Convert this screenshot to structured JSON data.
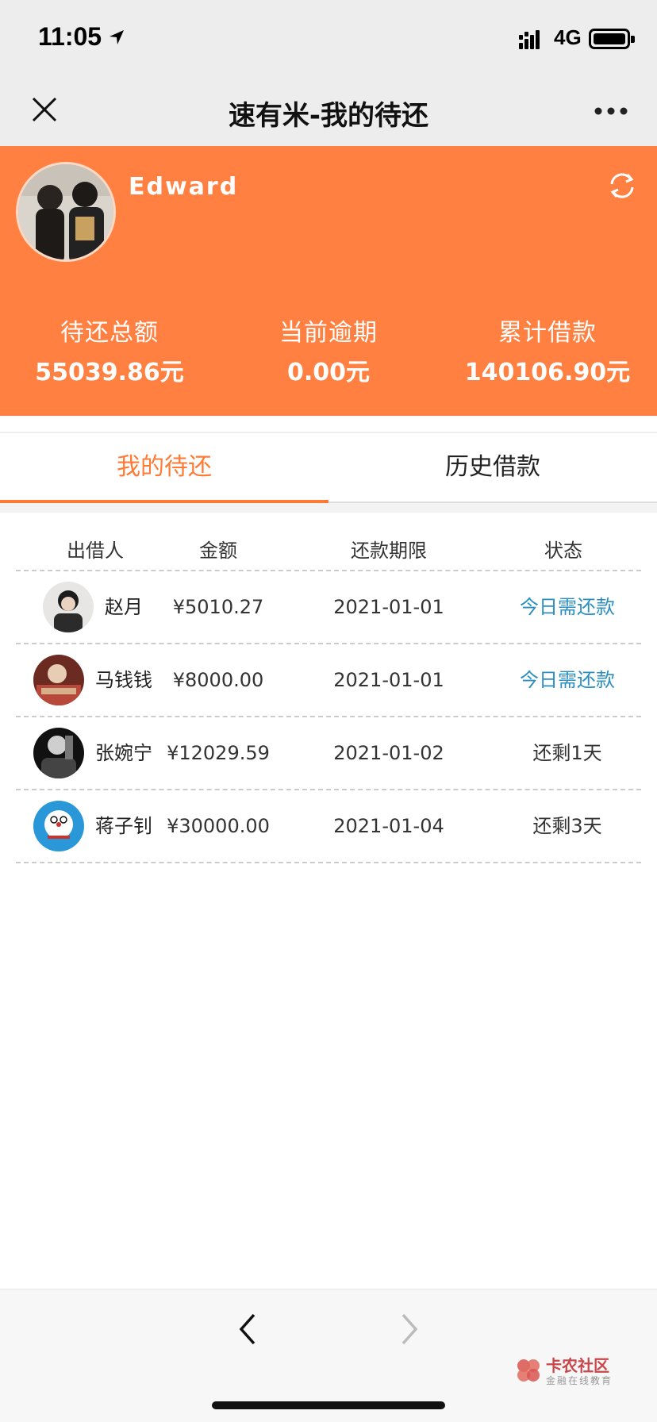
{
  "status_bar": {
    "time": "11:05",
    "network": "4G"
  },
  "nav": {
    "title": "速有米-我的待还"
  },
  "profile": {
    "username": "Edward"
  },
  "stats": [
    {
      "label": "待还总额",
      "value": "55039.86元"
    },
    {
      "label": "当前逾期",
      "value": "0.00元"
    },
    {
      "label": "累计借款",
      "value": "140106.90元"
    }
  ],
  "tabs": [
    {
      "label": "我的待还",
      "active": true
    },
    {
      "label": "历史借款",
      "active": false
    }
  ],
  "table": {
    "headers": {
      "lender": "出借人",
      "amount": "金额",
      "deadline": "还款期限",
      "status": "状态"
    },
    "rows": [
      {
        "lender": "赵月",
        "amount": "¥5010.27",
        "deadline": "2021-01-01",
        "status": "今日需还款"
      },
      {
        "lender": "马钱钱",
        "amount": "¥8000.00",
        "deadline": "2021-01-01",
        "status": "今日需还款"
      },
      {
        "lender": "张婉宁",
        "amount": "¥12029.59",
        "deadline": "2021-01-02",
        "status": "还剩1天"
      },
      {
        "lender": "蒋子钊",
        "amount": "¥30000.00",
        "deadline": "2021-01-04",
        "status": "还剩3天"
      }
    ]
  },
  "colors": {
    "accent": "#ff8040",
    "due": "#2a8fc0",
    "tab_active": "#ff7a35"
  },
  "watermark": {
    "title": "卡农社区",
    "subtitle": "金融在线教育"
  }
}
